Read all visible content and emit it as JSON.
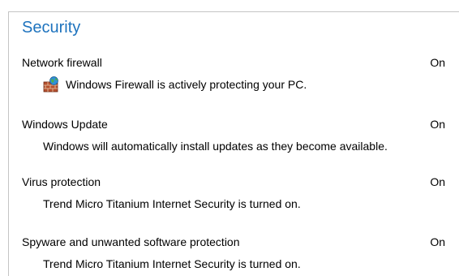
{
  "security": {
    "title": "Security",
    "items": [
      {
        "name": "Network firewall",
        "status": "On",
        "detail": "Windows Firewall is actively protecting your PC.",
        "icon": "firewall-icon"
      },
      {
        "name": "Windows Update",
        "status": "On",
        "detail": "Windows will automatically install updates as they become available."
      },
      {
        "name": "Virus protection",
        "status": "On",
        "detail": "Trend Micro Titanium Internet Security is turned on."
      },
      {
        "name": "Spyware and unwanted software protection",
        "status": "On",
        "detail": "Trend Micro Titanium Internet Security is turned on."
      }
    ]
  },
  "colors": {
    "accent": "#1e73be",
    "border": "#c4c4c4"
  }
}
